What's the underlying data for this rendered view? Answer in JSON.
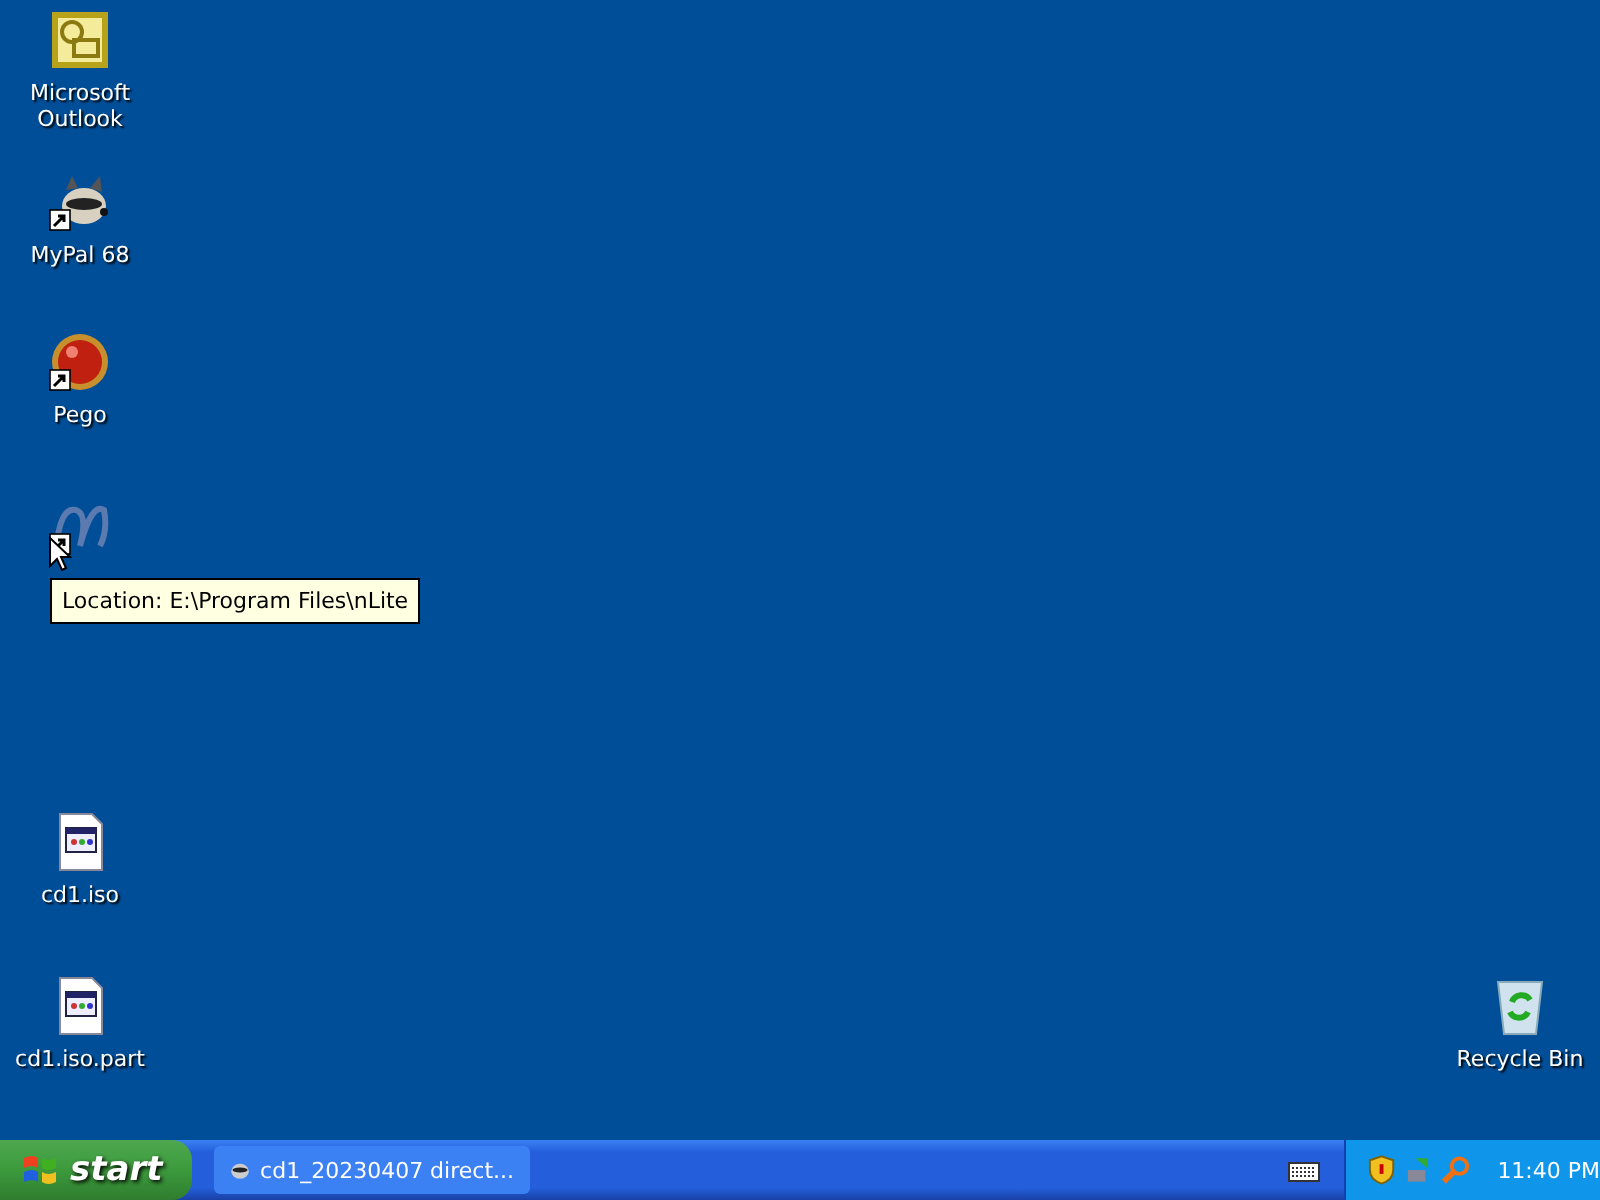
{
  "desktop_icons": [
    {
      "kind": "outlook",
      "label": "Microsoft Outlook",
      "shortcut": false
    },
    {
      "kind": "raccoon",
      "label": "MyPal 68",
      "shortcut": true
    },
    {
      "kind": "pego",
      "label": "Pego",
      "shortcut": true
    },
    {
      "kind": "nlite",
      "shortcut": true
    },
    {
      "kind": "iso",
      "label": "cd1.iso",
      "shortcut": false
    },
    {
      "kind": "iso",
      "label": "cd1.iso.part",
      "shortcut": false
    },
    {
      "kind": "recycle",
      "label": "Recycle Bin",
      "shortcut": false
    }
  ],
  "tooltip": "Location: E:\\Program Files\\nLite",
  "taskbar": {
    "start": "start",
    "tasks": [
      {
        "label": "cd1_20230407 direct...",
        "selected": false
      }
    ],
    "clock": "11:40 PM"
  }
}
